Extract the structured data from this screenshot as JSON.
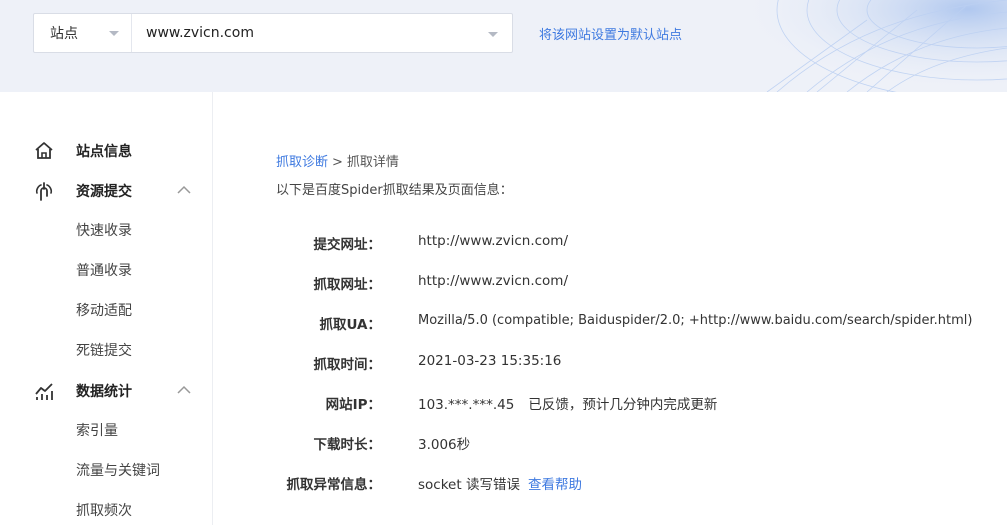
{
  "header": {
    "site_type_label": "站点",
    "site_url": "www.zvicn.com",
    "set_default_link": "将该网站设置为默认站点"
  },
  "sidebar": {
    "groups": [
      {
        "label": "站点信息",
        "icon": "home-icon",
        "expandable": false,
        "sub": []
      },
      {
        "label": "资源提交",
        "icon": "resource-submit-icon",
        "expandable": true,
        "expanded": true,
        "sub": [
          "快速收录",
          "普通收录",
          "移动适配",
          "死链提交"
        ]
      },
      {
        "label": "数据统计",
        "icon": "stats-chart-icon",
        "expandable": true,
        "expanded": true,
        "sub": [
          "索引量",
          "流量与关键词",
          "抓取频次"
        ]
      }
    ]
  },
  "main": {
    "breadcrumb": {
      "link": "抓取诊断",
      "separator": ">",
      "current": "抓取详情"
    },
    "intro": "以下是百度Spider抓取结果及页面信息：",
    "details": {
      "submit_url": {
        "label": "提交网址：",
        "value": "http://www.zvicn.com/"
      },
      "crawl_url": {
        "label": "抓取网址：",
        "value": "http://www.zvicn.com/"
      },
      "crawl_ua": {
        "label": "抓取UA：",
        "value": "Mozilla/5.0 (compatible; Baiduspider/2.0; +http://www.baidu.com/search/spider.html)"
      },
      "crawl_time": {
        "label": "抓取时间：",
        "value": "2021-03-23 15:35:16"
      },
      "site_ip": {
        "label": "网站IP：",
        "value": "103.***.***.45",
        "note": "已反馈，预计几分钟内完成更新"
      },
      "download_time": {
        "label": "下载时长：",
        "value": "3.006秒"
      },
      "crawl_error": {
        "label": "抓取异常信息：",
        "value": "socket 读写错误",
        "help_link": "查看帮助"
      }
    }
  },
  "colors": {
    "link": "#3f7ae0",
    "header_bg": "#eef1f8",
    "text": "#333333"
  }
}
